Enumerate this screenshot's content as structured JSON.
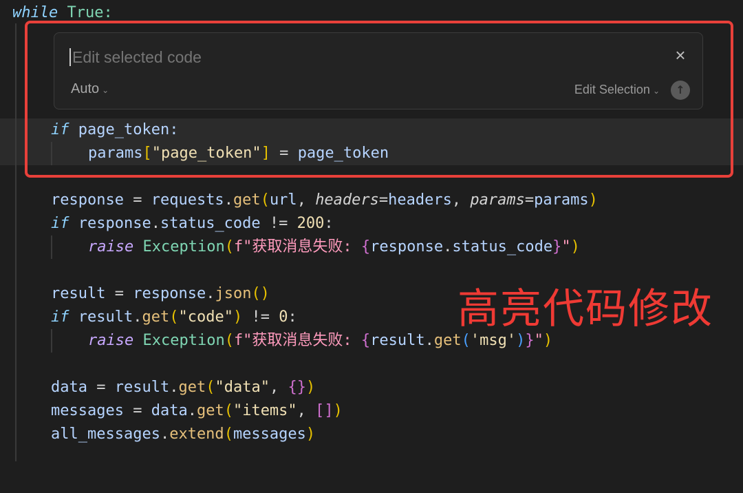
{
  "code": {
    "line_while": {
      "kw": "while",
      "rest": " True:"
    },
    "line_if_token": {
      "kw": "if",
      "rest": " page_token:"
    },
    "line_params": {
      "a": "params",
      "b": "[",
      "c": "\"page_token\"",
      "d": "]",
      "e": " = ",
      "f": "page_token"
    },
    "line_response": {
      "a": "response",
      "b": " = ",
      "c": "requests",
      "d": ".",
      "e": "get",
      "f": "(",
      "g": "url",
      "h": ", ",
      "i": "headers",
      "j": "=",
      "k": "headers",
      "l": ", ",
      "m": "params",
      "n": "=",
      "o": "params",
      "p": ")"
    },
    "line_if_status": {
      "kw": "if",
      "a": " response",
      "b": ".",
      "c": "status_code",
      "d": " != ",
      "e": "200",
      "f": ":"
    },
    "line_raise1": {
      "kw": "raise",
      "a": " Exception",
      "b": "(",
      "c": "f\"获取消息失败: ",
      "d": "{",
      "e": "response",
      "f": ".",
      "g": "status_code",
      "h": "}",
      "i": "\"",
      "j": ")"
    },
    "line_result": {
      "a": "result",
      "b": " = ",
      "c": "response",
      "d": ".",
      "e": "json",
      "f": "()"
    },
    "line_if_code": {
      "kw": "if",
      "a": " result",
      "b": ".",
      "c": "get",
      "d": "(",
      "e": "\"code\"",
      "f": ")",
      "g": " != ",
      "h": "0",
      "i": ":"
    },
    "line_raise2": {
      "kw": "raise",
      "a": " Exception",
      "b": "(",
      "c": "f\"获取消息失败: ",
      "d": "{",
      "e": "result",
      "f": ".",
      "g": "get",
      "h": "(",
      "i": "'msg'",
      "j": ")",
      "k": "}",
      "l": "\"",
      "m": ")"
    },
    "line_data": {
      "a": "data",
      "b": " = ",
      "c": "result",
      "d": ".",
      "e": "get",
      "f": "(",
      "g": "\"data\"",
      "h": ", ",
      "i": "{}",
      "j": ")"
    },
    "line_messages": {
      "a": "messages",
      "b": " = ",
      "c": "data",
      "d": ".",
      "e": "get",
      "f": "(",
      "g": "\"items\"",
      "h": ", ",
      "i": "[]",
      "j": ")"
    },
    "line_extend": {
      "a": "all_messages",
      "b": ".",
      "c": "extend",
      "d": "(",
      "e": "messages",
      "f": ")"
    }
  },
  "inline_edit": {
    "placeholder": "Edit selected code",
    "close_symbol": "×",
    "model_label": "Auto",
    "mode_label": "Edit Selection",
    "submit_symbol": "↑"
  },
  "annotation": {
    "text": "高亮代码修改"
  },
  "colors": {
    "highlight": "#e8403a",
    "background": "#1e1e1e"
  }
}
